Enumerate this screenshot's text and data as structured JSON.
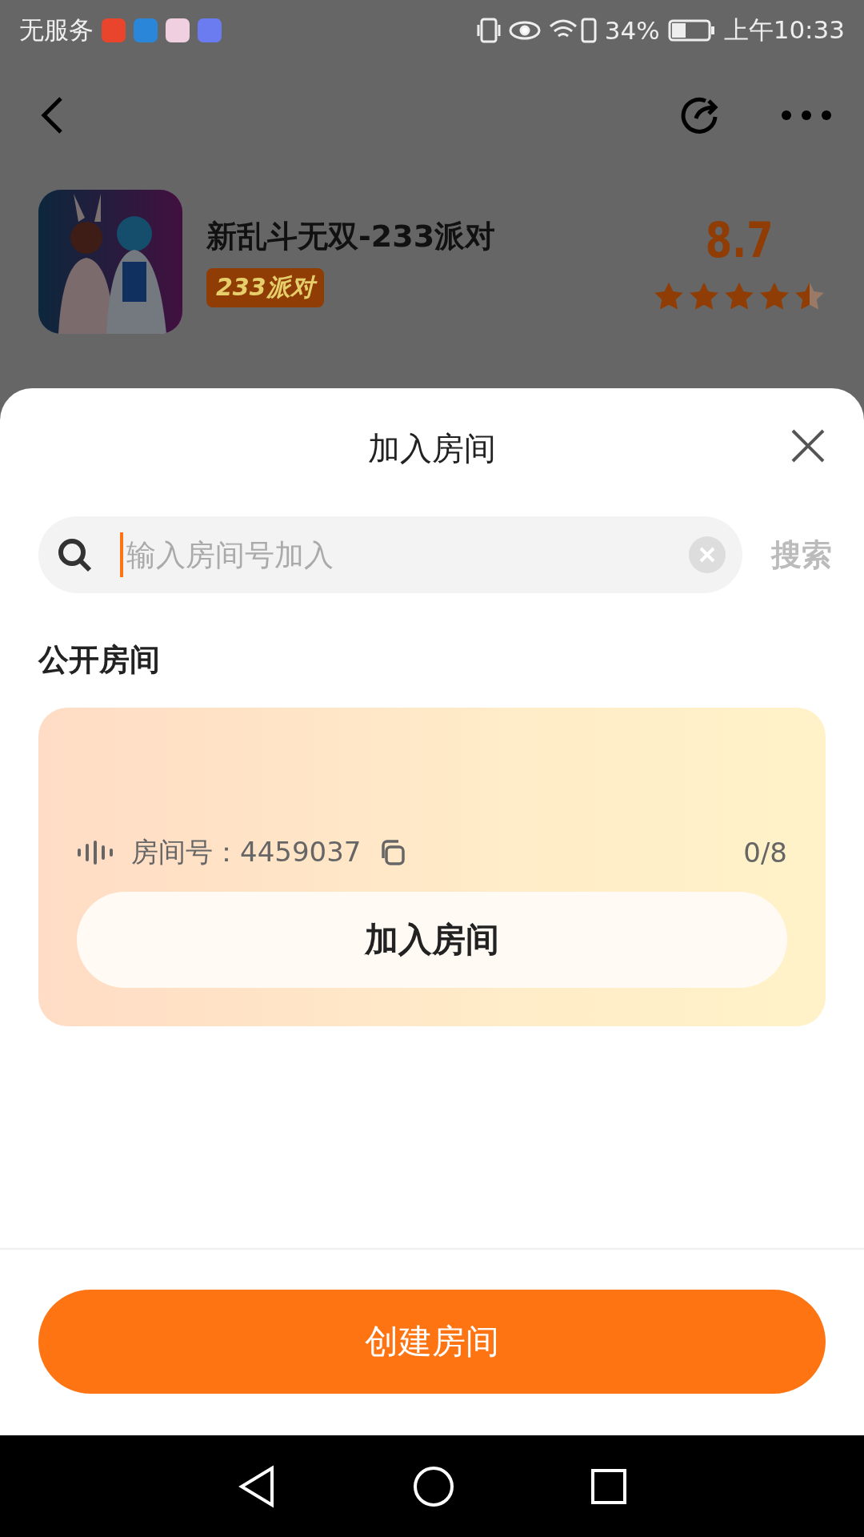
{
  "status_bar": {
    "carrier": "无服务",
    "battery": "34%",
    "time": "上午10:33"
  },
  "app": {
    "title": "新乱斗无双-233派对",
    "tag": "233派对",
    "rating": "8.7",
    "stars": 4.5
  },
  "sheet": {
    "title": "加入房间",
    "search": {
      "placeholder": "输入房间号加入"
    },
    "search_button": "搜索",
    "section_title": "公开房间",
    "rooms": [
      {
        "label": "房间号：",
        "number": "4459037",
        "count": "0/8",
        "button": "加入房间"
      }
    ],
    "create_button": "创建房间"
  }
}
